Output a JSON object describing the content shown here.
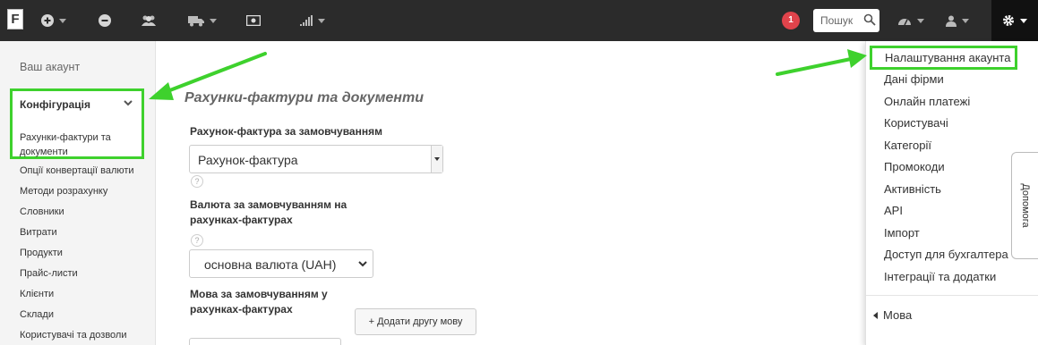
{
  "navbar": {
    "logo_text": "F",
    "notification_count": "1",
    "search_placeholder": "Пошук"
  },
  "sidebar": {
    "account_link": "Ваш акаунт",
    "section_title": "Конфігурація",
    "active_item": "Рахунки-фактури та документи",
    "items": [
      "Опції конвертації валюти",
      "Методи розрахунку",
      "Словники",
      "Витрати",
      "Продукти",
      "Прайс-листи",
      "Клієнти",
      "Склади",
      "Користувачі та дозволи"
    ]
  },
  "main": {
    "title": "Рахунки-фактури та документи",
    "default_invoice_label": "Рахунок-фактура за замовчуванням",
    "default_invoice_value": "Рахунок-фактура",
    "default_currency_label": "Валюта за замовчуванням на рахунках-фактурах",
    "default_currency_value": "основна валюта (UAH)",
    "default_language_label": "Мова за замовчуванням у рахунках-фактурах",
    "add_language_button": "+ Додати другу мову",
    "help_mark": "?"
  },
  "dropdown": {
    "items": [
      "Налаштування акаунта",
      "Дані фірми",
      "Онлайн платежі",
      "Користувачі",
      "Категорії",
      "Промокоди",
      "Активність",
      "API",
      "Імпорт",
      "Доступ для бухгалтера",
      "Інтеграції та додатки"
    ],
    "language": "Мова"
  },
  "help_tab": "Допомога",
  "colors": {
    "navbar": "#2b2b2b",
    "highlight": "#3ed12d",
    "badge": "#e0434b"
  }
}
